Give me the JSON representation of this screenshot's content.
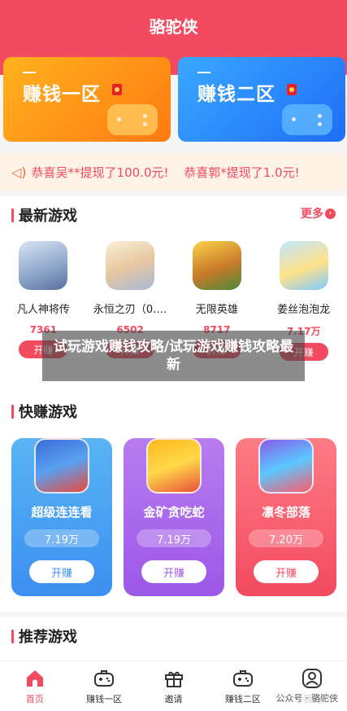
{
  "header": {
    "title": "骆驼侠"
  },
  "zones": [
    {
      "label": "赚钱一区"
    },
    {
      "label": "赚钱二区"
    }
  ],
  "notice": {
    "items": [
      "恭喜吴**提现了100.0元!",
      "恭喜郭*提现了1.0元!"
    ]
  },
  "latest": {
    "title": "最新游戏",
    "more": "更多",
    "games": [
      {
        "name": "凡人神将传",
        "count": "7361",
        "button": "开赚"
      },
      {
        "name": "永恒之刃（0.…",
        "count": "6502",
        "button": "开赚"
      },
      {
        "name": "无限英雄",
        "count": "8717",
        "button": "开赚"
      },
      {
        "name": "姜丝泡泡龙",
        "count": "7.17万",
        "button": "开赚"
      }
    ]
  },
  "overlay": {
    "text": "试玩游戏赚钱攻略/试玩游戏赚钱攻略最新"
  },
  "quick": {
    "title": "快赚游戏",
    "games": [
      {
        "name": "超级连连看",
        "amount": "7.19万",
        "button": "开赚"
      },
      {
        "name": "金矿贪吃蛇",
        "amount": "7.19万",
        "button": "开赚"
      },
      {
        "name": "凛冬部落",
        "amount": "7.20万",
        "button": "开赚"
      }
    ]
  },
  "recommend": {
    "title": "推荐游戏"
  },
  "tabs": [
    {
      "label": "首页"
    },
    {
      "label": "赚钱一区"
    },
    {
      "label": "邀请"
    },
    {
      "label": "赚钱二区"
    },
    {
      "label": "我的"
    }
  ],
  "watermark": "公众号 · 骆驼侠",
  "colors": {
    "brand": "#f24a5f",
    "orange": "#ff8a14",
    "blue": "#2a7cf6",
    "purple": "#9c58e8"
  }
}
